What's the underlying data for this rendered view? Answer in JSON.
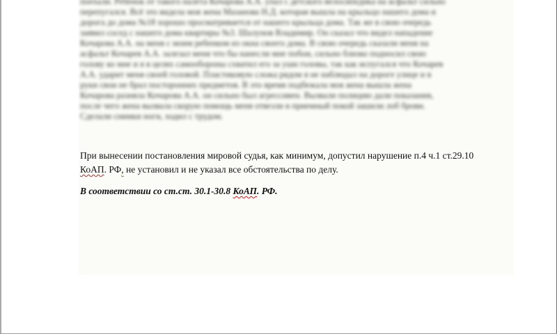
{
  "document": {
    "blurred_paragraph": {
      "lines": [
        "поехали. Ребенок от такого налета Кочарова А.А. упал с детского велосипедика на асфальт сильно",
        "перепугался. Всё это видела моя жена Мазанова Н.Д. которая вышла на крыльцо нашего дома и",
        "дорога до дома №18 хорошо просматривается от нашего крыльца дома. Так же в свою очередь",
        "заявил сосед с нашего дома квартиры №3. Шалунов Владимир. Он сказал что видел нападение",
        "Кочарова А.А. на меня с моим ребенком из окна своего дома. В свою очередь сказали меня на",
        "асфальт Кочарев А.А. залезал меня что бы нанесли мне побои, сильно близко подносил свою",
        "голову ко мне и я в целях самообороны схватил его за уши головы, так как испугался что Кочарев",
        "А.А. ударит меня своей головой. Пластиковую сложа рядом я не наблюдал на дороге улице и в",
        "руки свои не брал посторонних предметов. В это время подбежала моя жена вышла жена",
        "Кочарова разняла Кочарова А.А. он сильно был агрессивен. Вызвали полицию дали показания,",
        "после чего жена вызвала скорую помощь меня отвезли в приемный покой зашили лоб брови.",
        "Сделали снимки ноги, ходил с трудом."
      ]
    },
    "paragraph1": {
      "part1": "При вынесении постановления мировой судья, как минимум, допустил нарушение п.4 ч.1 ст.29.10",
      "part2_spell": "КоАП",
      "part3": ". РФ",
      "part4_grammar": ",",
      "part5": " не установил и не указал все обстоятельства по делу."
    },
    "paragraph2": {
      "part1": "В соответствии со ст.ст. 30.1-30.8 ",
      "part2_spell": "КоАП",
      "part3": ". РФ."
    }
  }
}
